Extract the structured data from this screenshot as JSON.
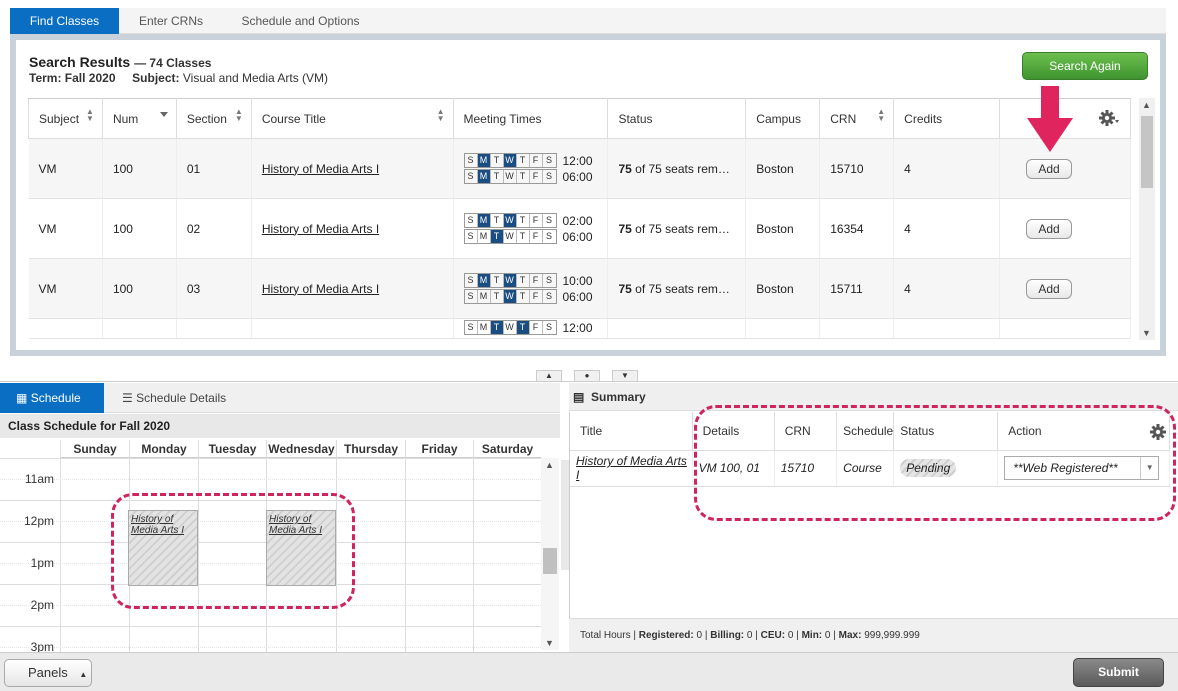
{
  "tabs": [
    "Find Classes",
    "Enter CRNs",
    "Schedule and Options"
  ],
  "search": {
    "title": "Search Results",
    "count": "— 74 Classes",
    "term_label": "Term:",
    "term_value": "Fall 2020",
    "subject_label": "Subject:",
    "subject_value": "Visual and Media Arts (VM)",
    "search_again": "Search Again"
  },
  "columns": [
    "Subject",
    "Num",
    "Section",
    "Course Title",
    "Meeting Times",
    "Status",
    "Campus",
    "CRN",
    "Credits"
  ],
  "day_letters": [
    "S",
    "M",
    "T",
    "W",
    "T",
    "F",
    "S"
  ],
  "rows": [
    {
      "subject": "VM",
      "num": "100",
      "section": "01",
      "title": "History of Media Arts I",
      "meetings": [
        {
          "days": [
            1,
            3
          ],
          "time": "12:00"
        },
        {
          "days": [
            1
          ],
          "time": "06:00"
        }
      ],
      "status_num": "75",
      "status_rest": " of 75 seats rem…",
      "campus": "Boston",
      "crn": "15710",
      "credits": "4",
      "add": "Add"
    },
    {
      "subject": "VM",
      "num": "100",
      "section": "02",
      "title": "History of Media Arts I",
      "meetings": [
        {
          "days": [
            1,
            3
          ],
          "time": "02:00"
        },
        {
          "days": [
            2
          ],
          "time": "06:00"
        }
      ],
      "status_num": "75",
      "status_rest": " of 75 seats rem…",
      "campus": "Boston",
      "crn": "16354",
      "credits": "4",
      "add": "Add"
    },
    {
      "subject": "VM",
      "num": "100",
      "section": "03",
      "title": "History of Media Arts I",
      "meetings": [
        {
          "days": [
            1,
            3
          ],
          "time": "10:00"
        },
        {
          "days": [
            3
          ],
          "time": "06:00"
        }
      ],
      "status_num": "75",
      "status_rest": " of 75 seats rem…",
      "campus": "Boston",
      "crn": "15711",
      "credits": "4",
      "add": "Add"
    },
    {
      "subject": "",
      "num": "",
      "section": "",
      "title": "",
      "meetings": [
        {
          "days": [
            2,
            4
          ],
          "time": "12:00"
        }
      ],
      "status_num": "",
      "status_rest": "",
      "campus": "",
      "crn": "",
      "credits": "",
      "add": ""
    }
  ],
  "schedule": {
    "tab_schedule": "Schedule",
    "tab_details": "Schedule Details",
    "heading": "Class Schedule for Fall 2020",
    "days": [
      "Sunday",
      "Monday",
      "Tuesday",
      "Wednesday",
      "Thursday",
      "Friday",
      "Saturday"
    ],
    "hours": [
      "11am",
      "12pm",
      "1pm",
      "2pm",
      "3pm"
    ],
    "event_label": "History of Media Arts I"
  },
  "summary": {
    "title": "Summary",
    "columns": [
      "Title",
      "Details",
      "CRN",
      "Schedule",
      "Status",
      "Action"
    ],
    "row": {
      "title": "History of Media Arts I",
      "details": "VM 100, 01",
      "crn": "15710",
      "schedule": "Course",
      "status": "Pending",
      "action": "**Web Registered**"
    },
    "footer_prefix": "Total Hours | ",
    "footer_registered": "Registered:",
    "footer_registered_val": " 0 | ",
    "footer_billing": "Billing:",
    "footer_billing_val": " 0 | ",
    "footer_ceu": "CEU:",
    "footer_ceu_val": " 0 | ",
    "footer_min": "Min:",
    "footer_min_val": " 0 | ",
    "footer_max": "Max:",
    "footer_max_val": " 999,999.999"
  },
  "bottom": {
    "panels": "Panels",
    "submit": "Submit"
  },
  "colors": {
    "tab_active": "#0a6fc2",
    "day_on": "#1a4e83",
    "search_again": "#4fa33a",
    "annotation": "#d0245f"
  }
}
